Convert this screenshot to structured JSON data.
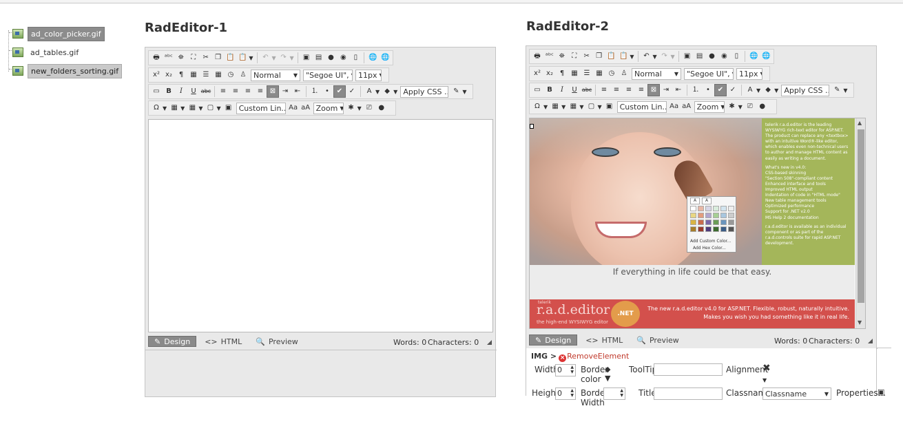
{
  "tree": {
    "items": [
      {
        "label": "ad_color_picker.gif"
      },
      {
        "label": "ad_tables.gif"
      },
      {
        "label": "new_folders_sorting.gif"
      }
    ]
  },
  "editor1": {
    "title": "RadEditor-1",
    "paragraph_style": "Normal",
    "font_name": "\"Segoe UI\",",
    "font_size": "11px",
    "apply_css": "Apply CSS ...",
    "custom_links": "Custom Lin...",
    "zoom": "Zoom",
    "modes": {
      "design": "Design",
      "html": "HTML",
      "preview": "Preview"
    },
    "words": "Words: 0",
    "characters": "Characters: 0"
  },
  "editor2": {
    "title": "RadEditor-2",
    "paragraph_style": "Normal",
    "font_name": "\"Segoe UI\",",
    "font_size": "11px",
    "apply_css": "Apply CSS ...",
    "custom_links": "Custom Lin...",
    "zoom": "Zoom",
    "modes": {
      "design": "Design",
      "html": "HTML",
      "preview": "Preview"
    },
    "words": "Words: 0",
    "characters": "Characters: 0",
    "content": {
      "promo_intro": "telerik r.a.d.editor is the leading WYSIWYG rich-text editor for ASP.NET. The product can replace any <textbox> with an intuitive Word®-like editor, which enables even non-technical users to author and manage HTML content as easily as writing a document.",
      "promo_whats_new": "What's new in v4.0:",
      "promo_list": [
        "CSS-based skinning",
        "\"Section 508\"-compliant content",
        "Enhanced interface and tools",
        "Improved HTML output",
        "Indentation of code in \"HTML mode\"",
        "New table management tools",
        "Optimized performance",
        "Support for .NET v2.0",
        "MS Help 2 documentation"
      ],
      "promo_outro": "r.a.d.editor is available as an individual component or as part of the r.a.d.controls suite for rapid ASP.NET development.",
      "popup_add_custom": "Add Custom Color...",
      "popup_add_hex": "Add Hex Color...",
      "caption": "If everything in life could be that easy.",
      "banner_logo": "r.a.d.editor",
      "banner_brand": "telerik",
      "banner_logo_sub": "the high-end WYSIWYG editor",
      "banner_badge": ".NET",
      "banner_line1": "The new r.a.d.editor v4.0 for ASP.NET. Flexible, robust, naturally intuitive.",
      "banner_line2": "Makes you wish you had something like it in real life."
    },
    "breadcrumb": {
      "tag": "IMG >",
      "remove": "RemoveElement"
    },
    "props": {
      "width_label": "Width",
      "width_value": "0",
      "height_label": "Height",
      "height_value": "0",
      "border_color_label": "Border color",
      "border_width_label": "Border Width",
      "tooltip_label": "ToolTip",
      "title_label": "Title",
      "alignment_label": "Alignment",
      "classname_label": "Classname",
      "classname_value": "Classname",
      "properties_label": "Properties..."
    }
  },
  "colors": {
    "accent_active": "#8a8a8a",
    "promo_green": "#a4b65a",
    "banner_red": "#d3504c"
  }
}
